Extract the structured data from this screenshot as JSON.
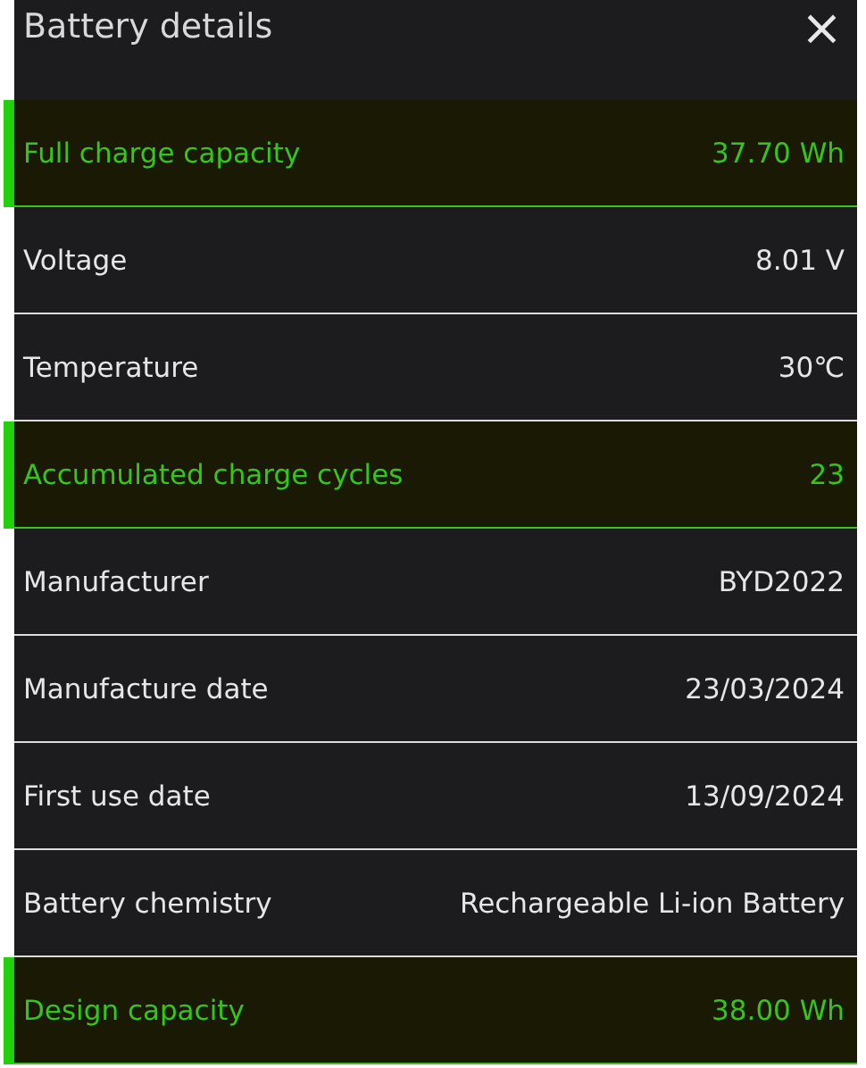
{
  "window": {
    "title": "Battery details",
    "close": "×"
  },
  "rows": [
    {
      "label": "Full charge capacity",
      "value": "37.70 Wh",
      "highlighted": true
    },
    {
      "label": "Voltage",
      "value": "8.01 V",
      "highlighted": false
    },
    {
      "label": "Temperature",
      "value": "30℃",
      "highlighted": false
    },
    {
      "label": "Accumulated charge cycles",
      "value": "23",
      "highlighted": true
    },
    {
      "label": "Manufacturer",
      "value": "BYD2022",
      "highlighted": false
    },
    {
      "label": "Manufacture date",
      "value": "23/03/2024",
      "highlighted": false
    },
    {
      "label": "First use date",
      "value": "13/09/2024",
      "highlighted": false
    },
    {
      "label": "Battery chemistry",
      "value": "Rechargeable Li-ion Battery",
      "highlighted": false
    },
    {
      "label": "Design capacity",
      "value": "38.00 Wh",
      "highlighted": true
    }
  ]
}
